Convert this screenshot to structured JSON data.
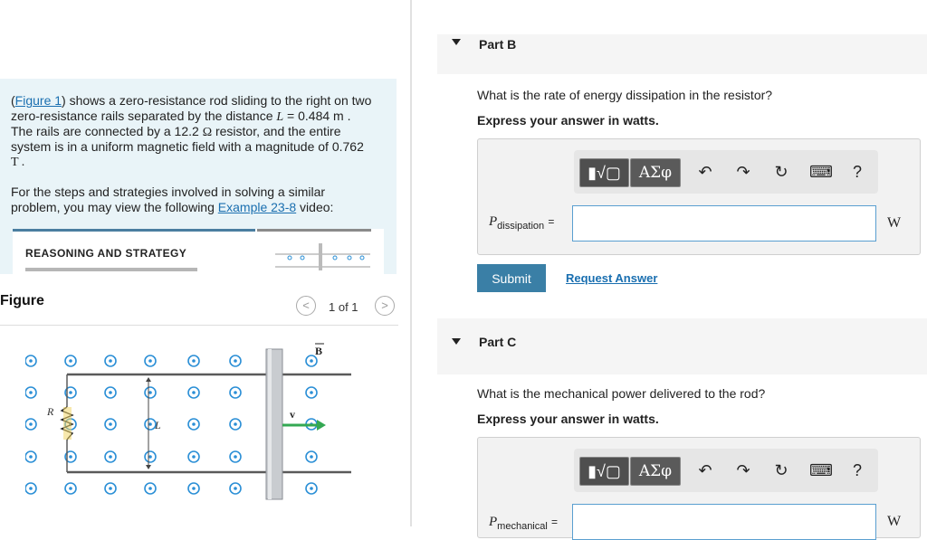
{
  "problem": {
    "figure_link": "Figure 1",
    "line1_rest": ") shows a zero-resistance rod sliding to the right on two",
    "line2_pre": "zero-resistance rails separated by the distance ",
    "L_symbol": "L",
    "L_value": " = 0.484 m .",
    "line3_pre": "The rails are connected by a 12.2 ",
    "ohm": "Ω",
    "line3_post": " resistor, and the entire",
    "line4": "system is in a uniform magnetic field with a magnitude of 0.762",
    "line5": "T .",
    "strategy_pre": "For the steps and strategies involved in solving a similar problem, you may view the following ",
    "example_link": "Example 23-8",
    "strategy_post": " video:"
  },
  "video_card": {
    "title": "REASONING AND STRATEGY"
  },
  "figure": {
    "header": "Figure",
    "pager": "1 of 1",
    "prev": "<",
    "next": ">",
    "label_B": "B",
    "label_v": "v",
    "label_R": "R",
    "label_L": "L"
  },
  "partB": {
    "label": "Part B",
    "question": "What is the rate of energy dissipation in the resistor?",
    "instruction": "Express your answer in watts.",
    "var_main": "P",
    "var_sub": "dissipation",
    "equals": "=",
    "unit": "W",
    "submit": "Submit",
    "request": "Request Answer"
  },
  "partC": {
    "label": "Part C",
    "question": "What is the mechanical power delivered to the rod?",
    "instruction": "Express your answer in watts.",
    "var_main": "P",
    "var_sub": "mechanical",
    "equals": "=",
    "unit": "W"
  },
  "toolbar": {
    "templates": "▮√▢",
    "greek": "ΑΣφ",
    "undo": "↶",
    "redo": "↷",
    "reset": "↻",
    "keyboard": "⌨",
    "help": "?"
  },
  "icons": [
    "undo-icon",
    "redo-icon",
    "reset-icon",
    "keyboard-icon",
    "help-icon",
    "chevron-left-icon",
    "chevron-right-icon",
    "disclosure-triangle-icon"
  ],
  "colors": {
    "accent": "#3a7fa6",
    "link": "#1a6fb0",
    "field_dot": "#2b8fd6",
    "problem_bg": "#e9f4f8"
  }
}
